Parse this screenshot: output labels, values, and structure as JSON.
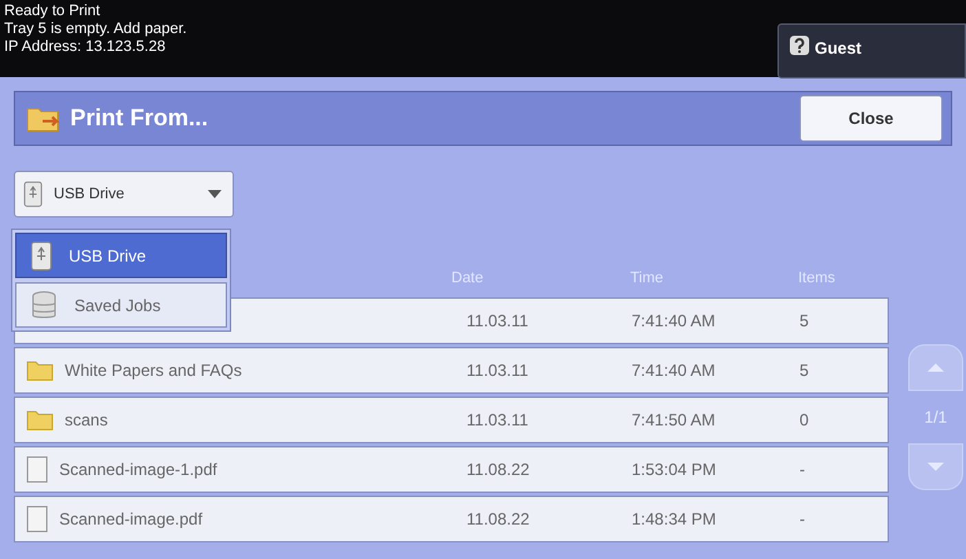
{
  "status": {
    "lines": [
      "Ready to Print",
      "Tray 5 is empty. Add paper.",
      "IP Address: 13.123.5.28"
    ]
  },
  "user": {
    "label": "Guest"
  },
  "header": {
    "title": "Print From...",
    "close": "Close"
  },
  "source": {
    "value": "USB Drive",
    "expanded": true,
    "options": [
      {
        "label": "USB Drive",
        "kind": "usb",
        "selected": true
      },
      {
        "label": "Saved Jobs",
        "kind": "jobs",
        "selected": false
      }
    ]
  },
  "table": {
    "columns": [
      "Date",
      "Time",
      "Items"
    ],
    "rows": [
      {
        "date": "11.03.11",
        "time": "7:41:40 AM",
        "items": "5"
      },
      {
        "kind": "folder",
        "name": "White Papers and FAQs",
        "date": "11.03.11",
        "time": "7:41:40 AM",
        "items": "5"
      },
      {
        "kind": "folder",
        "name": "scans",
        "date": "11.03.11",
        "time": "7:41:50 AM",
        "items": "0"
      },
      {
        "kind": "file",
        "name": "Scanned-image-1.pdf",
        "date": "11.08.22",
        "time": "1:53:04 PM",
        "items": "-"
      },
      {
        "kind": "file",
        "name": "Scanned-image.pdf",
        "date": "11.08.22",
        "time": "1:48:34 PM",
        "items": "-"
      }
    ]
  },
  "pager": {
    "page": "1/1"
  }
}
